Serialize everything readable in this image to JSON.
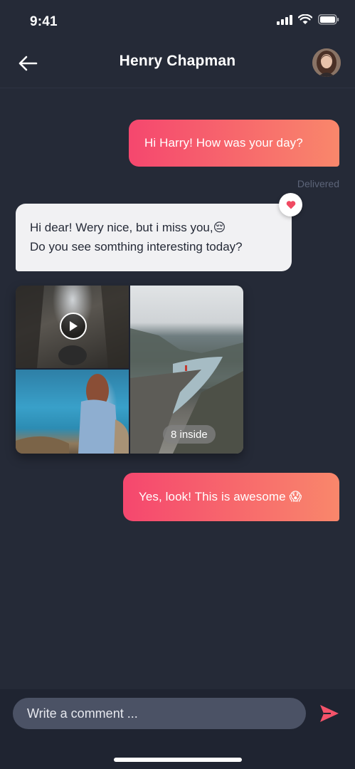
{
  "status_bar": {
    "time": "9:41",
    "icons": [
      "signal-icon",
      "wifi-icon",
      "battery-icon"
    ]
  },
  "header": {
    "title": "Henry Chapman",
    "back_icon": "arrow-left-icon",
    "avatar": "contact-avatar"
  },
  "messages": [
    {
      "direction": "outgoing",
      "text": "Hi Harry! How was your day?"
    },
    {
      "direction": "incoming",
      "lines": [
        "Hi dear! Wery nice, but i miss you,😔",
        "Do you see somthing interesting today?"
      ],
      "reaction": "heart-icon"
    },
    {
      "direction": "incoming",
      "type": "gallery",
      "badge": "8 inside",
      "tiles": [
        "waterfall-video",
        "cliff-photo",
        "beach-photo"
      ]
    },
    {
      "direction": "outgoing",
      "text": "Yes, look! This is awesome 😱"
    }
  ],
  "delivered_label": "Delivered",
  "composer": {
    "placeholder": "Write a comment ...",
    "send_icon": "send-icon"
  },
  "colors": {
    "background": "#252a37",
    "gradient_start": "#f5476e",
    "gradient_end": "#f9876b",
    "incoming_bubble": "#f1f1f3",
    "input_bg": "#4b5265"
  }
}
